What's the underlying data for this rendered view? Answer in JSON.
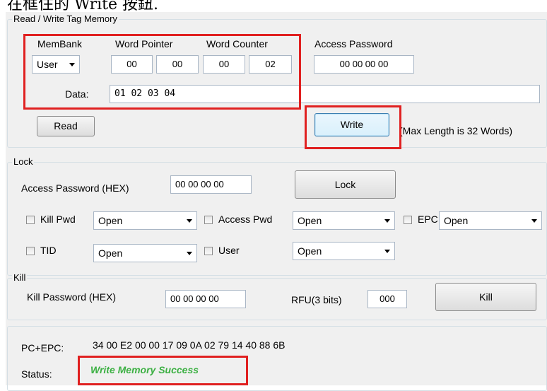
{
  "top_caption": "在框住的 Write 按鈕.",
  "rw": {
    "title": "Read / Write Tag Memory",
    "membank_label": "MemBank",
    "membank_value": "User",
    "word_pointer_label": "Word Pointer",
    "word_pointer": [
      "00",
      "00"
    ],
    "word_counter_label": "Word Counter",
    "word_counter": [
      "00",
      "02"
    ],
    "access_password_label": "Access Password",
    "access_password": "00 00 00 00",
    "data_label": "Data:",
    "data_value": "01 02 03 04",
    "read_button": "Read",
    "write_button": "Write",
    "max_length_note": "(Max Length is 32 Words)"
  },
  "lock": {
    "title": "Lock",
    "access_password_label": "Access Password (HEX)",
    "access_password": "00 00 00 00",
    "lock_button": "Lock",
    "kill_pwd_label": "Kill Pwd",
    "kill_pwd_value": "Open",
    "access_pwd_label": "Access Pwd",
    "access_pwd_value": "Open",
    "epc_label": "EPC",
    "epc_value": "Open",
    "tid_label": "TID",
    "tid_value": "Open",
    "user_label": "User",
    "user_value": "Open"
  },
  "kill": {
    "title": "Kill",
    "password_label": "Kill Password (HEX)",
    "password": "00 00 00 00",
    "rfu_label": "RFU(3 bits)",
    "rfu_value": "000",
    "kill_button": "Kill"
  },
  "info": {
    "pc_epc_label": "PC+EPC:",
    "pc_epc_value": "34 00 E2 00 00 17 09 0A 02 79 14 40 88 6B",
    "status_label": "Status:",
    "status_value": "Write Memory Success"
  },
  "colors": {
    "highlight": "#e02020",
    "status_success": "#3cb043"
  }
}
